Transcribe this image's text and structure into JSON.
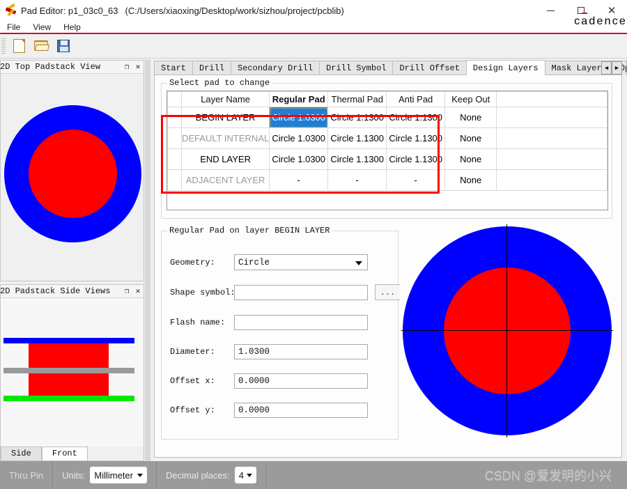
{
  "window": {
    "title": "Pad Editor: p1_03c0_63",
    "path": "(C:/Users/xiaoxing/Desktop/work/sizhou/project/pcblib)",
    "app_icon": "pad-editor-icon",
    "minimize": "–",
    "maximize": "□",
    "close": "✕"
  },
  "menu": {
    "items": [
      {
        "label": "File"
      },
      {
        "label": "View"
      },
      {
        "label": "Help"
      }
    ],
    "brand": "cadence"
  },
  "toolbar": {
    "buttons": [
      {
        "name": "new-file-button",
        "icon": "new-file-icon",
        "tooltip": "New"
      },
      {
        "name": "open-file-button",
        "icon": "open-folder-icon",
        "tooltip": "Open"
      },
      {
        "name": "save-file-button",
        "icon": "save-floppy-icon",
        "tooltip": "Save"
      }
    ]
  },
  "left_panels": [
    {
      "id": "top-padstack-view",
      "title": "2D Top Padstack View",
      "float_btn": "❐",
      "close_btn": "✕",
      "graphic": {
        "outer_color": "#0000ff",
        "inner_color": "#fe0000",
        "background": "#f0f0f0"
      }
    },
    {
      "id": "padstack-side-views",
      "title": "2D Padstack Side Views",
      "float_btn": "❐",
      "close_btn": "✕",
      "graphic": {
        "top_bar_color": "#0000ff",
        "mid_bar_color": "#9a9a9a",
        "bottom_bar_color": "#00e800",
        "body_color": "#fe0000"
      },
      "tabs": [
        {
          "label": "Side",
          "active": false
        },
        {
          "label": "Front",
          "active": true
        }
      ]
    }
  ],
  "main": {
    "tabs": [
      {
        "label": "Start",
        "active": false
      },
      {
        "label": "Drill",
        "active": false
      },
      {
        "label": "Secondary Drill",
        "active": false
      },
      {
        "label": "Drill Symbol",
        "active": false
      },
      {
        "label": "Drill Offset",
        "active": false
      },
      {
        "label": "Design Layers",
        "active": true
      },
      {
        "label": "Mask Layers",
        "active": false
      },
      {
        "label": "Options",
        "active": false
      }
    ],
    "tab_scroll_left": "◀",
    "tab_scroll_right": "▶",
    "select_group_title": "Select pad to change",
    "table": {
      "headers": [
        "",
        "Layer Name",
        "Regular Pad",
        "Thermal Pad",
        "Anti Pad",
        "Keep Out"
      ],
      "bold_header_index": 2,
      "rows": [
        {
          "layer": "BEGIN LAYER",
          "dim": false,
          "regular": "Circle 1.0300",
          "thermal": "Circle 1.1300",
          "anti": "Circle 1.1300",
          "keepout": "None",
          "selected_column": "regular"
        },
        {
          "layer": "DEFAULT INTERNAL",
          "dim": true,
          "regular": "Circle 1.0300",
          "thermal": "Circle 1.1300",
          "anti": "Circle 1.1300",
          "keepout": "None",
          "selected_column": ""
        },
        {
          "layer": "END LAYER",
          "dim": false,
          "regular": "Circle 1.0300",
          "thermal": "Circle 1.1300",
          "anti": "Circle 1.1300",
          "keepout": "None",
          "selected_column": ""
        },
        {
          "layer": "ADJACENT LAYER",
          "dim": true,
          "regular": "-",
          "thermal": "-",
          "anti": "-",
          "keepout": "None",
          "selected_column": ""
        }
      ],
      "highlight_color": "#ff0000"
    },
    "detail_group_title": "Regular Pad on layer BEGIN LAYER",
    "fields": [
      {
        "name": "geometry",
        "label": "Geometry:",
        "type": "combo",
        "value": "Circle",
        "placeholder": ""
      },
      {
        "name": "shape-symbol",
        "label": "Shape symbol:",
        "type": "text",
        "value": "",
        "placeholder": "",
        "browse": "..."
      },
      {
        "name": "flash-name",
        "label": "Flash name:",
        "type": "text",
        "value": "",
        "placeholder": ""
      },
      {
        "name": "diameter",
        "label": "Diameter:",
        "type": "text",
        "value": "1.0300",
        "placeholder": ""
      },
      {
        "name": "offset-x",
        "label": "Offset x:",
        "type": "text",
        "value": "0.0000",
        "placeholder": ""
      },
      {
        "name": "offset-y",
        "label": "Offset y:",
        "type": "text",
        "value": "0.0000",
        "placeholder": ""
      }
    ],
    "preview": {
      "outer_color": "#0000ff",
      "inner_color": "#fe0000",
      "crosshair_color": "#000000"
    }
  },
  "statusbar": {
    "pad_type": "Thru Pin",
    "units_label": "Units:",
    "units_value": "Millimeter",
    "decimal_label": "Decimal places:",
    "decimal_value": "4",
    "watermark": "CSDN @爱发明的小兴"
  }
}
